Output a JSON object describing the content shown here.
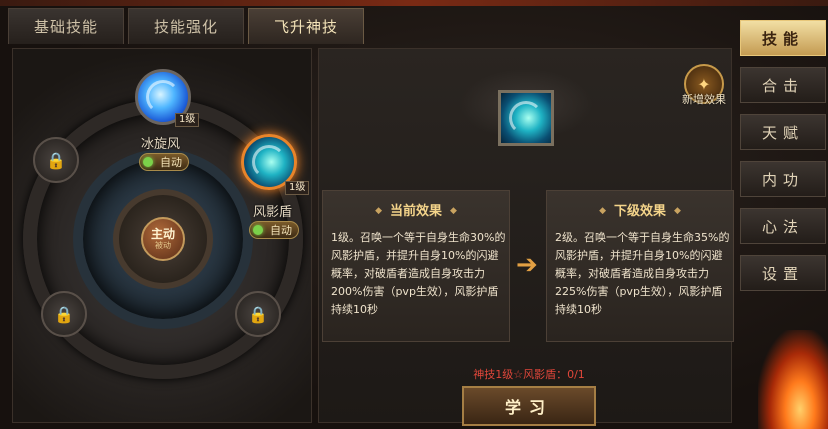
{
  "tabs": [
    {
      "label": "基础技能",
      "active": false
    },
    {
      "label": "技能强化",
      "active": false
    },
    {
      "label": "飞升神技",
      "active": true
    }
  ],
  "wheel": {
    "center_main": "主动",
    "center_sub": "被动",
    "skills": [
      {
        "name": "冰旋风",
        "level": "1级",
        "auto_label": "自动"
      },
      {
        "name": "风影盾",
        "level": "1级",
        "auto_label": "自动"
      }
    ]
  },
  "new_effect_label": "新增效果",
  "current_effect": {
    "title": "当前效果",
    "text": "1级。召唤一个等于自身生命30%的风影护盾，并提升自身10%的闪避概率，对破盾者造成自身攻击力200%伤害（pvp生效），风影护盾持续10秒"
  },
  "next_effect": {
    "title": "下级效果",
    "text": "2级。召唤一个等于自身生命35%的风影护盾，并提升自身10%的闪避概率，对破盾者造成自身攻击力225%伤害（pvp生效），风影护盾持续10秒"
  },
  "progress_text": "神技1级☆风影盾：0/1",
  "learn_button": "学习",
  "side_menu": [
    {
      "label": "技能",
      "active": true
    },
    {
      "label": "合击",
      "active": false
    },
    {
      "label": "天赋",
      "active": false
    },
    {
      "label": "内功",
      "active": false
    },
    {
      "label": "心法",
      "active": false
    },
    {
      "label": "设置",
      "active": false
    }
  ],
  "colors": {
    "accent_gold": "#f4d48a",
    "progress_red": "#e0463a",
    "active_menu": "#c49b52"
  }
}
